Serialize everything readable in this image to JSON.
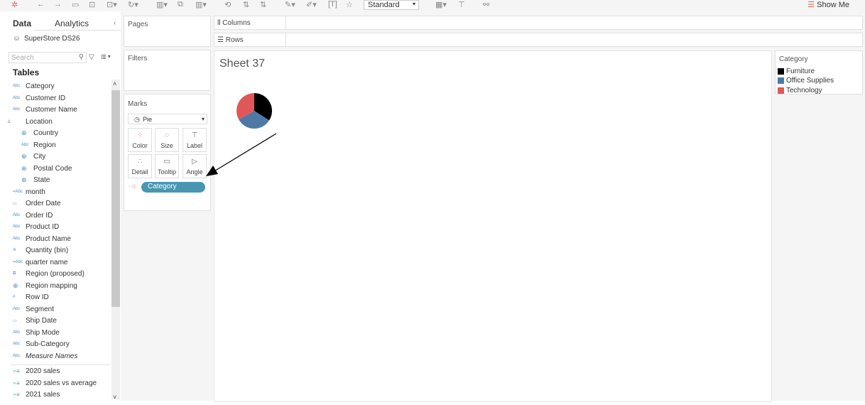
{
  "toolbar": {
    "format_value": "Standard",
    "show_me": "Show Me"
  },
  "left_pane": {
    "tabs": [
      "Data",
      "Analytics"
    ],
    "datasource": "SuperStore DS26",
    "search_placeholder": "Search",
    "tables_heading": "Tables",
    "dimensions": [
      {
        "icon": "Abc",
        "label": "Category",
        "indent": 0
      },
      {
        "icon": "Abc",
        "label": "Customer ID",
        "indent": 0
      },
      {
        "icon": "Abc",
        "label": "Customer Name",
        "indent": 0
      },
      {
        "icon": "hierarchy",
        "label": "Location",
        "indent": 0
      },
      {
        "icon": "globe",
        "label": "Country",
        "indent": 1
      },
      {
        "icon": "Abc",
        "label": "Region",
        "indent": 1
      },
      {
        "icon": "globe",
        "label": "City",
        "indent": 1
      },
      {
        "icon": "globe",
        "label": "Postal Code",
        "indent": 1
      },
      {
        "icon": "globe",
        "label": "State",
        "indent": 1
      },
      {
        "icon": "=Abc",
        "label": "month",
        "indent": 0
      },
      {
        "icon": "calendar",
        "label": "Order Date",
        "indent": 0
      },
      {
        "icon": "Abc",
        "label": "Order ID",
        "indent": 0
      },
      {
        "icon": "Abc",
        "label": "Product ID",
        "indent": 0
      },
      {
        "icon": "Abc",
        "label": "Product Name",
        "indent": 0
      },
      {
        "icon": "bin",
        "label": "Quantity (bin)",
        "indent": 0
      },
      {
        "icon": "=Abc",
        "label": "quarter name",
        "indent": 0
      },
      {
        "icon": "group",
        "label": "Region (proposed)",
        "indent": 0
      },
      {
        "icon": "globe",
        "label": "Region mapping",
        "indent": 0
      },
      {
        "icon": "#",
        "label": "Row ID",
        "indent": 0
      },
      {
        "icon": "Abc",
        "label": "Segment",
        "indent": 0
      },
      {
        "icon": "calendar",
        "label": "Ship Date",
        "indent": 0
      },
      {
        "icon": "Abc",
        "label": "Ship Mode",
        "indent": 0
      },
      {
        "icon": "Abc",
        "label": "Sub-Category",
        "indent": 0
      },
      {
        "icon": "Abc",
        "label": "Measure Names",
        "indent": 0
      }
    ],
    "measures": [
      {
        "label": "2020 sales"
      },
      {
        "label": "2020 sales vs average"
      },
      {
        "label": "2021 sales"
      }
    ]
  },
  "pages": {
    "title": "Pages"
  },
  "filters": {
    "title": "Filters"
  },
  "marks": {
    "title": "Marks",
    "mark_type": "Pie",
    "buttons": [
      "Color",
      "Size",
      "Label",
      "Detail",
      "Tooltip",
      "Angle"
    ],
    "pill": "Category"
  },
  "shelves": {
    "columns": "Columns",
    "rows": "Rows"
  },
  "sheet": {
    "title": "Sheet 37"
  },
  "chart_data": {
    "type": "pie",
    "categories": [
      "Furniture",
      "Office Supplies",
      "Technology"
    ],
    "values": [
      0.34,
      0.33,
      0.33
    ],
    "colors": [
      "#000000",
      "#4e79a7",
      "#e15759"
    ]
  },
  "legend": {
    "title": "Category",
    "items": [
      {
        "label": "Furniture",
        "color": "#000000"
      },
      {
        "label": "Office Supplies",
        "color": "#4e79a7"
      },
      {
        "label": "Technology",
        "color": "#e15759"
      }
    ]
  }
}
